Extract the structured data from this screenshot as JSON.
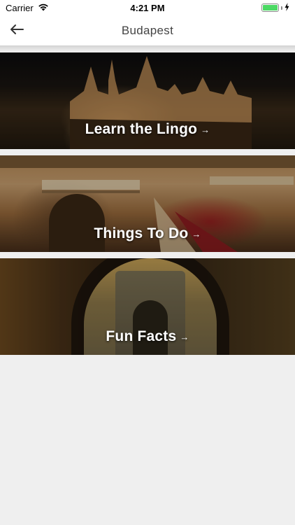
{
  "status_bar": {
    "carrier": "Carrier",
    "time": "4:21 PM",
    "battery_level": 1.0,
    "battery_color": "#4cd964",
    "wifi_icon": "wifi-icon",
    "charging_icon": "bolt-icon"
  },
  "nav": {
    "title": "Budapest",
    "back_icon": "arrow-left-icon"
  },
  "cards": [
    {
      "label": "Learn the Lingo",
      "arrow": "→"
    },
    {
      "label": "Things To Do",
      "arrow": "→"
    },
    {
      "label": "Fun Facts",
      "arrow": "→"
    }
  ]
}
